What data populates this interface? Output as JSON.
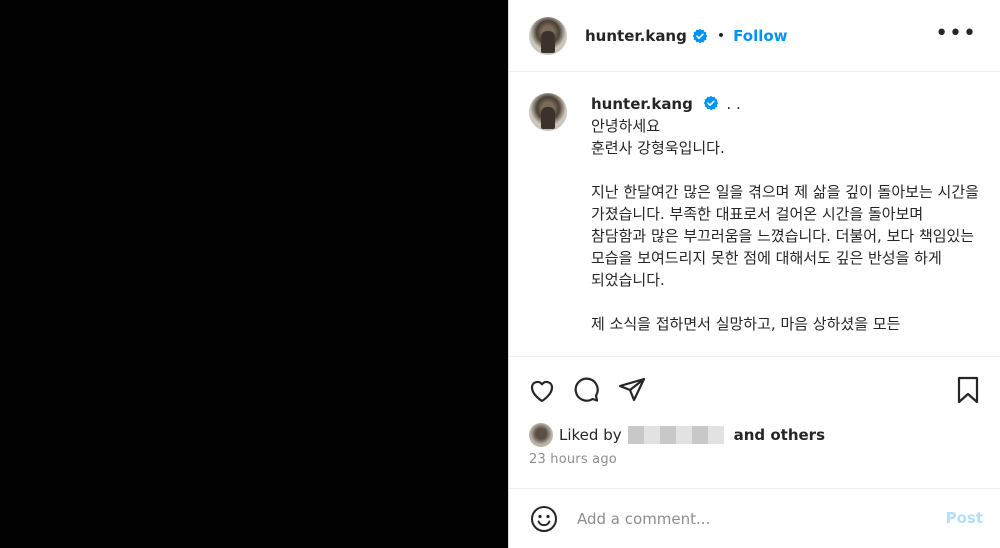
{
  "post": {
    "author": {
      "username": "hunter.kang",
      "verified_icon": "verified-badge-icon",
      "follow_label": "Follow",
      "separator": "•"
    },
    "more_icon": "more-options-icon",
    "caption": {
      "username": "hunter.kang",
      "dots": ". .",
      "text": "안녕하세요\n훈련사 강형욱입니다.\n\n지난 한달여간 많은 일을 겪으며 제 삶을 깊이 돌아보는 시간을 가졌습니다. 부족한 대표로서 걸어온 시간을 돌아보며 참담함과 많은 부끄러움을 느꼈습니다. 더불어, 보다 책임있는 모습을 보여드리지 못한 점에 대해서도 깊은 반성을 하게 되었습니다.\n\n제 소식을 접하면서 실망하고, 마음 상하셨을 모든"
    },
    "actions": {
      "like_icon": "heart-icon",
      "comment_icon": "comment-icon",
      "share_icon": "send-icon",
      "save_icon": "bookmark-icon"
    },
    "likes": {
      "prefix": "Liked by",
      "suffix": "and others"
    },
    "timestamp": "23 hours ago",
    "comment": {
      "emoji_icon": "emoji-icon",
      "placeholder": "Add a comment...",
      "post_label": "Post"
    },
    "colors": {
      "accent": "#0095f6",
      "post_disabled": "#b2dffc",
      "muted": "#8e8e8e"
    }
  }
}
